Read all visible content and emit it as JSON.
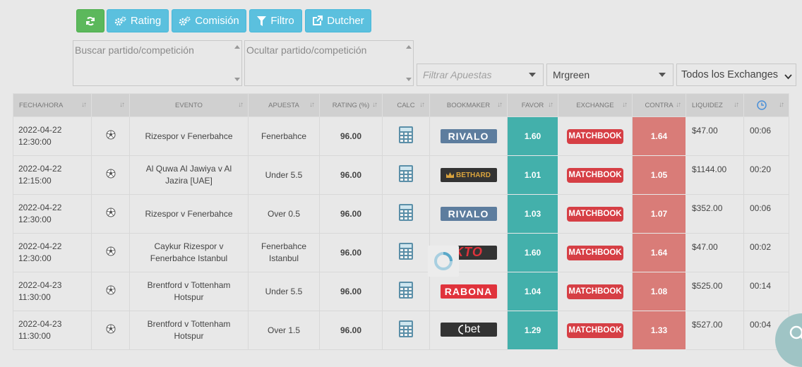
{
  "toolbar": {
    "rating_label": "Rating",
    "comision_label": "Comisión",
    "filtro_label": "Filtro",
    "dutcher_label": "Dutcher"
  },
  "search": {
    "buscar_placeholder": "Buscar partido/competición",
    "ocultar_placeholder": "Ocultar partido/competición"
  },
  "filters": {
    "apuestas_placeholder": "Filtrar Apuestas",
    "bookmaker_value": "Mrgreen",
    "exchange_value": "Todos los Exchanges"
  },
  "table": {
    "headers": [
      "FECHA/HORA",
      "",
      "EVENTO",
      "APUESTA",
      "RATING (%)",
      "CALC",
      "BOOKMAKER",
      "FAVOR",
      "EXCHANGE",
      "CONTRA",
      "LIQUIDEZ",
      ""
    ],
    "rows": [
      {
        "date": "2022-04-22",
        "time": "12:30:00",
        "event": "Rizespor v Fenerbahce",
        "bet": "Fenerbahce",
        "rating": "96.00",
        "bookmaker": "RIVALO",
        "favor": "1.60",
        "exchange": "MATCHBOOK",
        "contra": "1.64",
        "liquidity": "$47.00",
        "elapsed": "00:06"
      },
      {
        "date": "2022-04-22",
        "time": "12:15:00",
        "event": "Al Quwa Al Jawiya v Al Jazira [UAE]",
        "bet": "Under 5.5",
        "rating": "96.00",
        "bookmaker": "BETHARD",
        "favor": "1.01",
        "exchange": "MATCHBOOK",
        "contra": "1.05",
        "liquidity": "$1144.00",
        "elapsed": "00:20"
      },
      {
        "date": "2022-04-22",
        "time": "12:30:00",
        "event": "Rizespor v Fenerbahce",
        "bet": "Over 0.5",
        "rating": "96.00",
        "bookmaker": "RIVALO",
        "favor": "1.03",
        "exchange": "MATCHBOOK",
        "contra": "1.07",
        "liquidity": "$352.00",
        "elapsed": "00:06"
      },
      {
        "date": "2022-04-22",
        "time": "12:30:00",
        "event": "Caykur Rizespor v Fenerbahce Istanbul",
        "bet": "Fenerbahce Istanbul",
        "rating": "96.00",
        "bookmaker": "KTO",
        "favor": "1.60",
        "exchange": "MATCHBOOK",
        "contra": "1.64",
        "liquidity": "$47.00",
        "elapsed": "00:02"
      },
      {
        "date": "2022-04-23",
        "time": "11:30:00",
        "event": "Brentford v Tottenham Hotspur",
        "bet": "Under 5.5",
        "rating": "96.00",
        "bookmaker": "RABONA",
        "favor": "1.04",
        "exchange": "MATCHBOOK",
        "contra": "1.08",
        "liquidity": "$525.00",
        "elapsed": "00:14"
      },
      {
        "date": "2022-04-23",
        "time": "11:30:00",
        "event": "Brentford v Tottenham Hotspur",
        "bet": "Over 1.5",
        "rating": "96.00",
        "bookmaker": "Cbet",
        "favor": "1.29",
        "exchange": "MATCHBOOK",
        "contra": "1.33",
        "liquidity": "$527.00",
        "elapsed": "00:04"
      }
    ]
  },
  "bookmaker_logos": {
    "RIVALO": "RIVALO",
    "BETHARD": "BETHARD",
    "KTO": "KTO",
    "RABONA": "RABONA",
    "Cbet": "bet"
  },
  "colors": {
    "favor": "#43b0ab",
    "contra": "#d97c78",
    "matchbook": "#d63f45",
    "refresh_button": "#5cb85c",
    "toolbar_button": "#5bc0de"
  }
}
